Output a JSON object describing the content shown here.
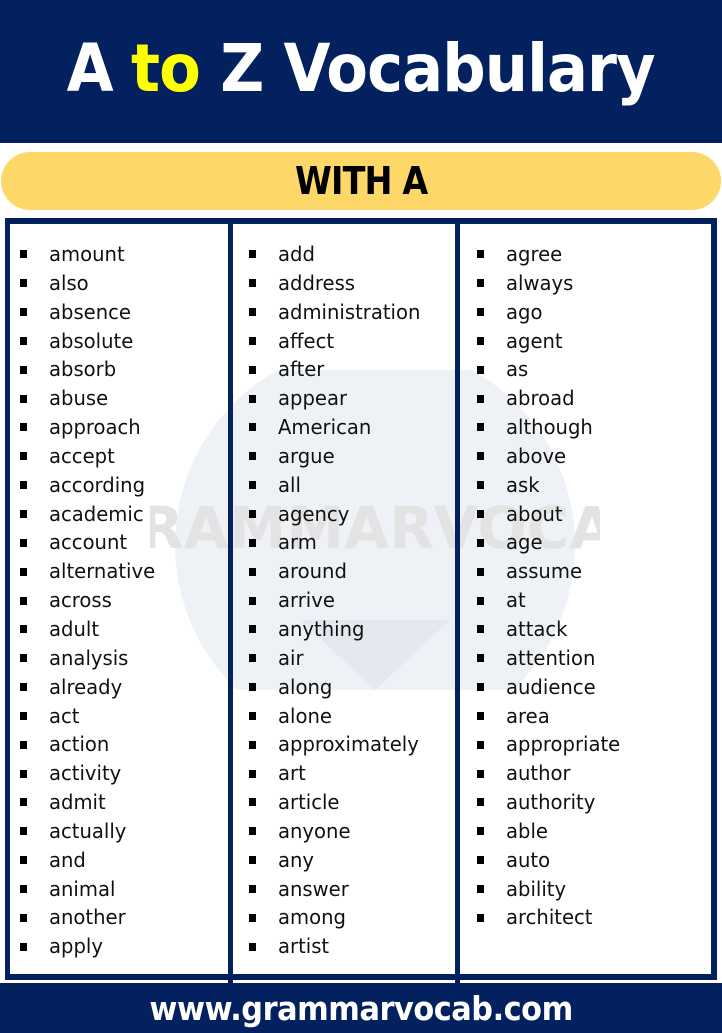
{
  "header": {
    "title_part1": "A",
    "title_highlight": "to",
    "title_part2": "Z Vocabulary",
    "highlight_color": "#ffff00",
    "background_color": "#03215f"
  },
  "banner": {
    "label": "WITH A",
    "background_color": "#fdd868"
  },
  "watermark": {
    "text": "GRAMMARVOCAB"
  },
  "columns": [
    {
      "words": [
        "amount",
        "also",
        "absence",
        "absolute",
        "absorb",
        "abuse",
        "approach",
        "accept",
        "according",
        "academic",
        "account",
        "alternative",
        "across",
        "adult",
        "analysis",
        "already",
        "act",
        "action",
        "activity",
        "admit",
        "actually",
        "and",
        "animal",
        "another",
        "apply"
      ]
    },
    {
      "words": [
        "add",
        "address",
        "administration",
        "affect",
        "after",
        "appear",
        "American",
        "argue",
        "all",
        "agency",
        "arm",
        "around",
        "arrive",
        "anything",
        "air",
        "along",
        "alone",
        "approximately",
        "art",
        "article",
        "anyone",
        "any",
        "answer",
        "among",
        "artist"
      ]
    },
    {
      "words": [
        "agree",
        "always",
        "ago",
        "agent",
        "as",
        "abroad",
        "although",
        "above",
        "ask",
        "about",
        "age",
        "assume",
        "at",
        "attack",
        "attention",
        "audience",
        "area",
        "appropriate",
        "author",
        "authority",
        "able",
        "auto",
        "ability",
        "architect"
      ]
    }
  ],
  "footer": {
    "url": "www.grammarvocab.com"
  }
}
